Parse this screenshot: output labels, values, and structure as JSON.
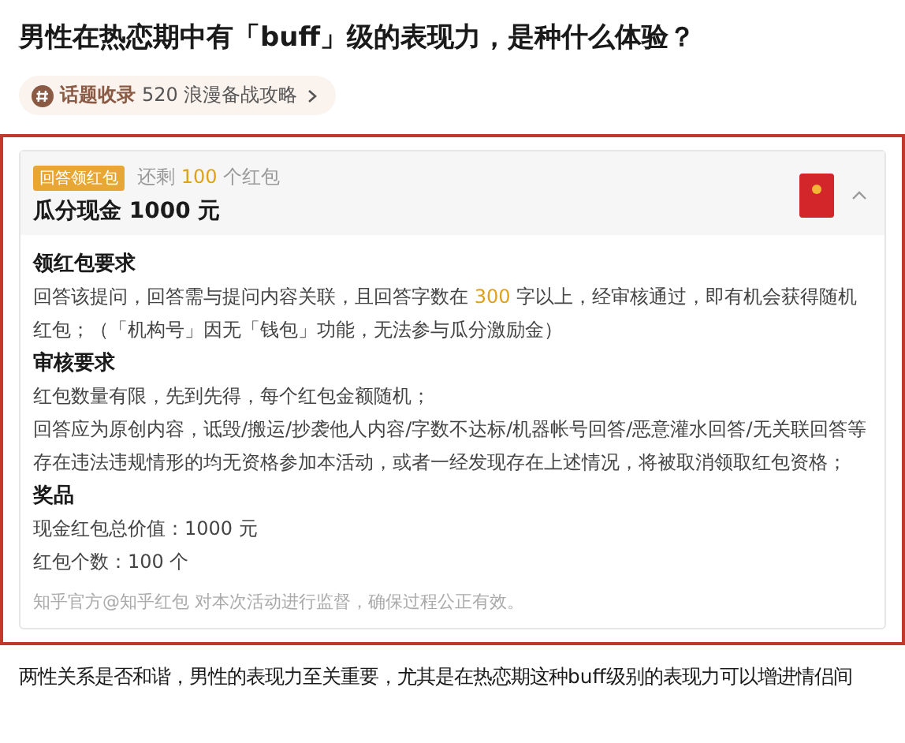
{
  "question": {
    "title": "男性在热恋期中有「buff」级的表现力，是种什么体验？"
  },
  "topic": {
    "label": "话题收录",
    "name": "520 浪漫备战攻略"
  },
  "campaign": {
    "badge": "回答领红包",
    "remaining": [
      {
        "text": "还剩 "
      },
      {
        "text": "100",
        "highlight": true
      },
      {
        "text": " 个红包"
      }
    ],
    "heading": "瓜分现金 1000 元",
    "expanded": true,
    "sections": [
      {
        "heading": "领红包要求",
        "paragraphs": [
          [
            {
              "text": "回答该提问，回答需与提问内容关联，且回答字数在 "
            },
            {
              "text": "300",
              "highlight": true
            },
            {
              "text": " 字以上，经审核通过，即有机会获得随机红包；（「机构号」因无「钱包」功能，无法参与瓜分激励金）"
            }
          ]
        ]
      },
      {
        "heading": "审核要求",
        "paragraphs": [
          [
            {
              "text": "红包数量有限，先到先得，每个红包金额随机；"
            }
          ],
          [
            {
              "text": "回答应为原创内容，诋毁/搬运/抄袭他人内容/字数不达标/机器帐号回答/恶意灌水回答/无关联回答等存在违法违规情形的均无资格参加本活动，或者一经发现存在上述情况，将被取消领取红包资格；"
            }
          ]
        ]
      },
      {
        "heading": "奖品",
        "paragraphs": [
          [
            {
              "text": "现金红包总价值：1000 元"
            }
          ],
          [
            {
              "text": "红包个数：100 个"
            }
          ]
        ]
      }
    ],
    "note": "知乎官方@知乎红包 对本次活动进行监督，确保过程公正有效。"
  },
  "article": {
    "text": "两性关系是否和谐，男性的表现力至关重要，尤其是在热恋期这种buff级别的表现力可以增进情侣间"
  }
}
